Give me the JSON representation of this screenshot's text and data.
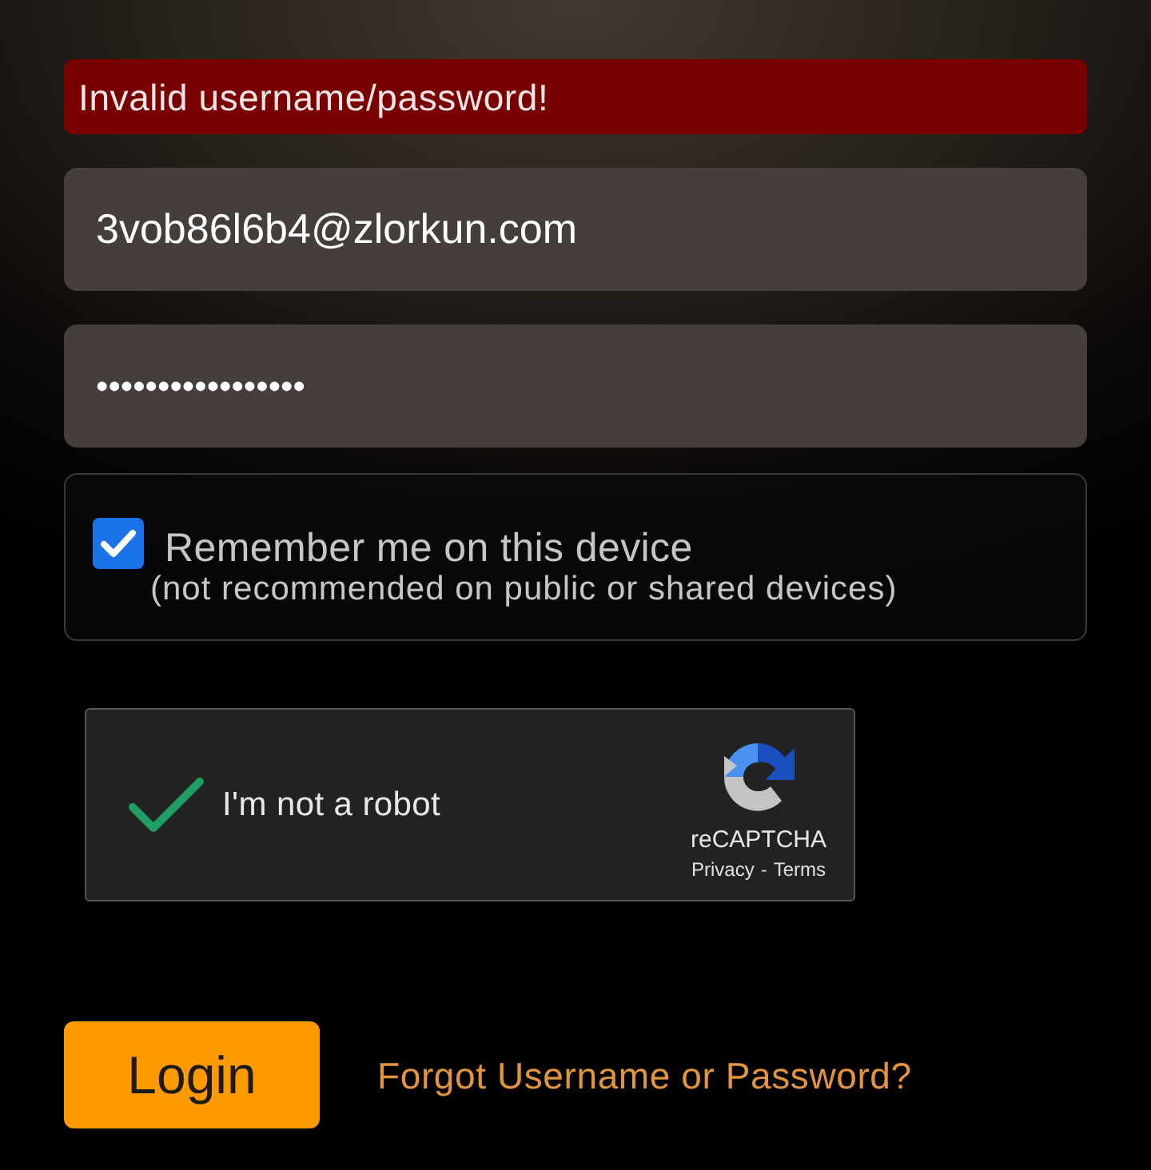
{
  "error_banner": {
    "text": "Invalid username/password!"
  },
  "fields": [
    {
      "kind": "email",
      "value": "3vob86l6b4@zlorkun.com"
    },
    {
      "kind": "password",
      "value": "•••••••••••••••••"
    }
  ],
  "remember": {
    "checked": true,
    "label": "Remember me on this device",
    "note": "(not recommended on public or shared devices)"
  },
  "captcha": {
    "checked": true,
    "label": "I'm not a robot",
    "brand": "reCAPTCHA",
    "links": [
      "Privacy",
      "Terms"
    ],
    "separator": "-"
  },
  "login_button": {
    "label": "Login"
  },
  "forgot_link": {
    "text": "Forgot Username or Password?"
  }
}
